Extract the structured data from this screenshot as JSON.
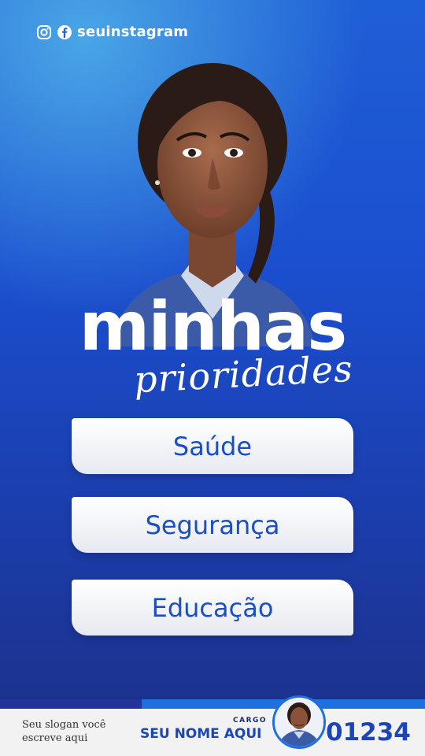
{
  "header": {
    "handle": "seuinstagram",
    "icons": [
      "instagram-icon",
      "facebook-icon"
    ]
  },
  "title": {
    "main": "minhas",
    "script": "prioridades"
  },
  "priorities": [
    {
      "label": "Saúde"
    },
    {
      "label": "Segurança"
    },
    {
      "label": "Educação"
    }
  ],
  "footer": {
    "slogan": "Seu slogan você escreve aqui",
    "cargo": "CARGO",
    "nome": "SEU NOME AQUI",
    "numero": "01234"
  },
  "colors": {
    "background_top": "#1f5fd6",
    "background_bottom": "#1c2f86",
    "card_text": "#1a4fc4",
    "accent_band": "#1e6fe0"
  }
}
